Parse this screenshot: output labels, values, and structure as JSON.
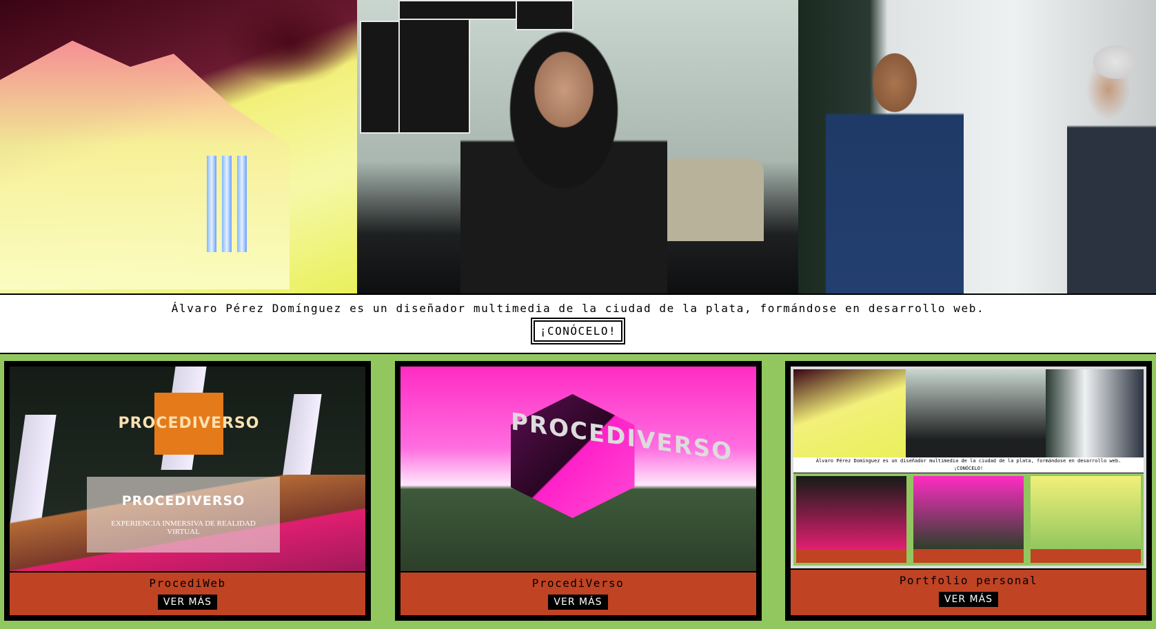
{
  "intro": {
    "text": "Álvaro Pérez Domínguez es un diseñador multimedia de la ciudad de la plata, formándose en desarrollo web.",
    "button_label": "¡CONÓCELO!"
  },
  "cards": [
    {
      "title": "ProcediWeb",
      "button_label": "VER MÁS",
      "thumb_logo": "PROCEDIVERSO",
      "thumb_heading": "PROCEDIVERSO",
      "thumb_subheading": "EXPERIENCIA INMERSIVA DE REALIDAD VIRTUAL"
    },
    {
      "title": "ProcediVerso",
      "button_label": "VER MÁS",
      "thumb_logo": "PROCEDIVERSO"
    },
    {
      "title": "Portfolio personal",
      "button_label": "VER MÁS",
      "mini_text": "Álvaro Pérez Domínguez es un diseñador multimedia de la ciudad de la plata, formándose en desarrollo web.",
      "mini_button": "¡CONÓCELO!"
    }
  ]
}
